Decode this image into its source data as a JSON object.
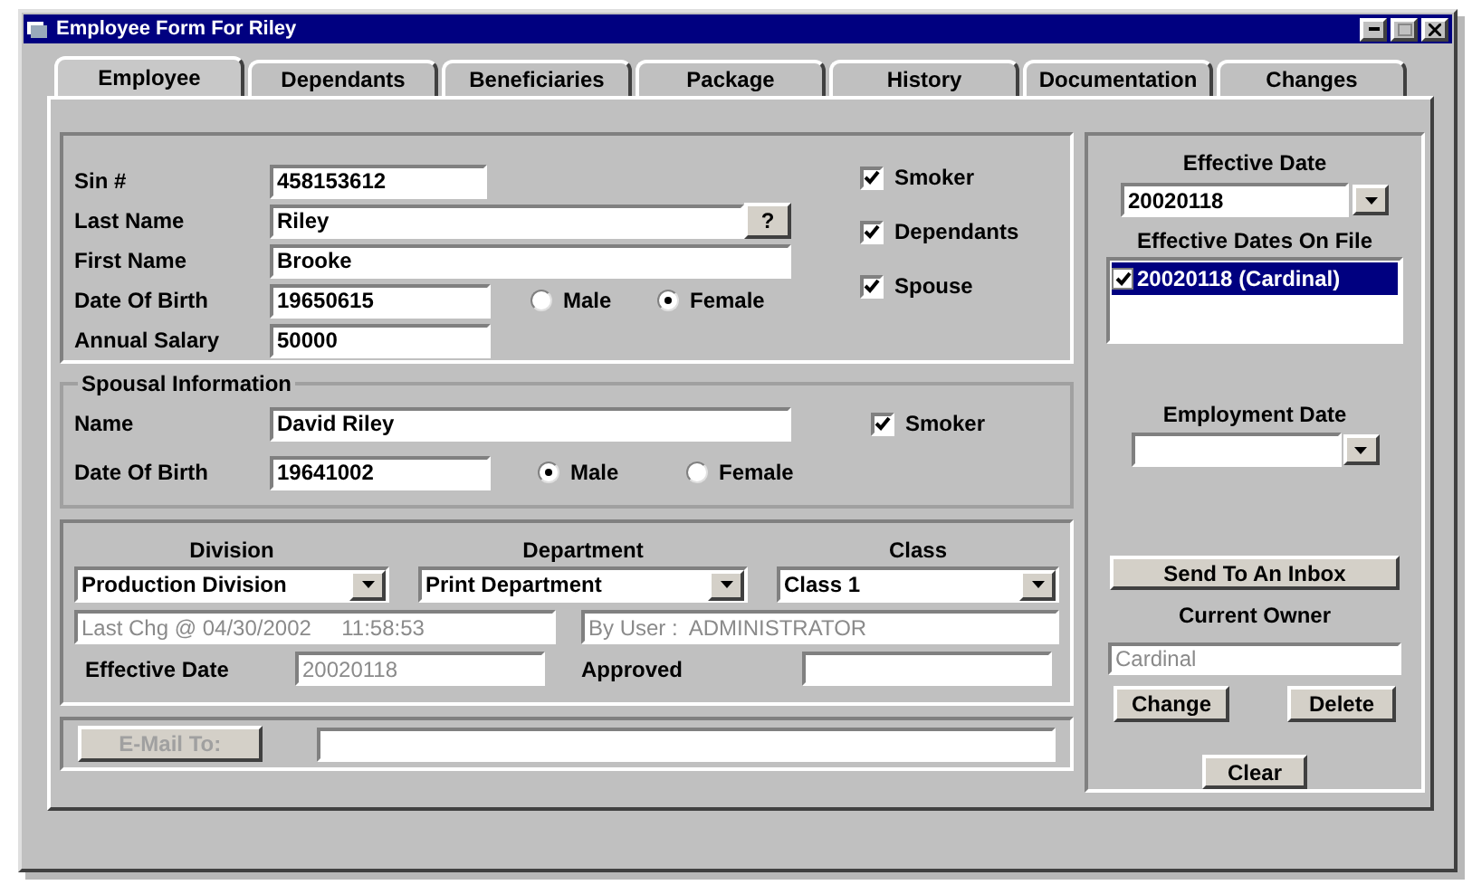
{
  "window": {
    "title": "Employee Form For Riley"
  },
  "tabs": [
    {
      "label": "Employee",
      "selected": true
    },
    {
      "label": "Dependants",
      "selected": false
    },
    {
      "label": "Beneficiaries",
      "selected": false
    },
    {
      "label": "Package",
      "selected": false
    },
    {
      "label": "History",
      "selected": false
    },
    {
      "label": "Documentation",
      "selected": false
    },
    {
      "label": "Changes",
      "selected": false
    }
  ],
  "employee": {
    "sin": {
      "label": "Sin #",
      "value": "458153612"
    },
    "last_name": {
      "label": "Last Name",
      "value": "Riley",
      "lookup_button": "?"
    },
    "first_name": {
      "label": "First Name",
      "value": "Brooke"
    },
    "date_of_birth": {
      "label": "Date Of Birth",
      "value": "19650615"
    },
    "annual_salary": {
      "label": "Annual Salary",
      "value": "50000"
    },
    "gender_options": [
      {
        "label": "Male",
        "selected": false
      },
      {
        "label": "Female",
        "selected": true
      }
    ],
    "checkboxes": [
      {
        "label": "Smoker",
        "checked": true
      },
      {
        "label": "Dependants",
        "checked": true
      },
      {
        "label": "Spouse",
        "checked": true
      }
    ]
  },
  "spouse": {
    "title": "Spousal Information",
    "name": {
      "label": "Name",
      "value": "David Riley"
    },
    "smoker": {
      "label": "Smoker",
      "checked": true
    },
    "date_of_birth": {
      "label": "Date Of Birth",
      "value": "19641002"
    },
    "gender_options": [
      {
        "label": "Male",
        "selected": true
      },
      {
        "label": "Female",
        "selected": false
      }
    ]
  },
  "assignment": {
    "dropdowns": [
      {
        "label": "Division",
        "value": "Production Division"
      },
      {
        "label": "Department",
        "value": "Print Department"
      },
      {
        "label": "Class",
        "value": "Class 1"
      }
    ],
    "last_change": {
      "value": "Last Chg @ 04/30/2002     11:58:53",
      "disabled": true
    },
    "by_user": {
      "value": "By User :  ADMINISTRATOR",
      "disabled": true
    },
    "effective_date": {
      "label": "Effective Date",
      "value": "20020118",
      "disabled": true
    },
    "approved": {
      "label": "Approved"
    }
  },
  "email": {
    "button": {
      "label": "E-Mail To:",
      "disabled": true
    }
  },
  "side": {
    "effective_date": {
      "label": "Effective Date",
      "value": "20020118"
    },
    "dates_on_file": {
      "label": "Effective Dates On File",
      "items": [
        {
          "label": "20020118 (Cardinal)",
          "checked": true,
          "selected": true
        }
      ]
    },
    "employment_date": {
      "label": "Employment Date"
    },
    "send_button": "Send To An Inbox",
    "current_owner": {
      "label": "Current Owner",
      "value": "Cardinal",
      "disabled": true
    },
    "buttons": [
      "Change",
      "Delete"
    ],
    "clear_button": "Clear"
  }
}
